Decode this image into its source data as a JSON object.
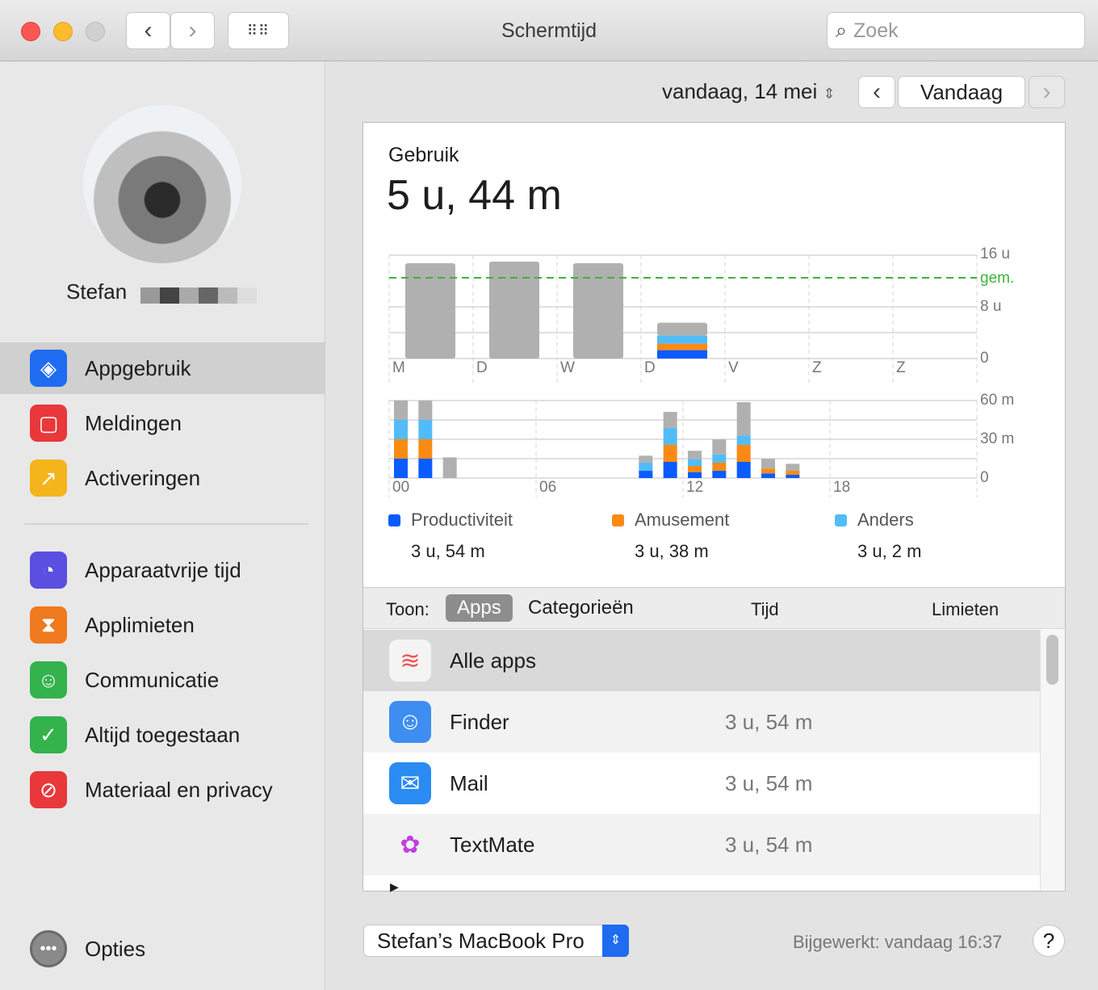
{
  "window": {
    "title": "Schermtijd",
    "search_placeholder": "Zoek"
  },
  "date_nav": {
    "date": "vandaag, 14 mei",
    "today_button": "Vandaag"
  },
  "user": {
    "name": "Stefan"
  },
  "sidebar": {
    "items": [
      {
        "label": "Appgebruik",
        "icon": "layers-icon",
        "color": "#1f6cf0",
        "selected": true
      },
      {
        "label": "Meldingen",
        "icon": "notification-icon",
        "color": "#e8383b"
      },
      {
        "label": "Activeringen",
        "icon": "pickup-icon",
        "color": "#f3b51b"
      },
      {
        "label": "Apparaatvrije tijd",
        "icon": "downtime-icon",
        "color": "#5a4fe0"
      },
      {
        "label": "Applimieten",
        "icon": "hourglass-icon",
        "color": "#f07a1e"
      },
      {
        "label": "Communicatie",
        "icon": "contact-icon",
        "color": "#34b24c"
      },
      {
        "label": "Altijd toegestaan",
        "icon": "checkmark-badge-icon",
        "color": "#34b24c"
      },
      {
        "label": "Materiaal en privacy",
        "icon": "restriction-icon",
        "color": "#e8383b"
      }
    ],
    "options_label": "Opties"
  },
  "usage": {
    "heading": "Gebruik",
    "total": "5 u, 44 m"
  },
  "colors": {
    "Productiviteit": "#0a5cff",
    "Amusement": "#fb8a14",
    "Anders": "#52bcf8",
    "other": "#b0b0b0",
    "average": "#3bb33b"
  },
  "chart_data": [
    {
      "type": "bar",
      "stacked": true,
      "categories": [
        "M",
        "D",
        "W",
        "D",
        "V",
        "Z",
        "Z"
      ],
      "y_ticks": [
        "16 u",
        "8 u",
        "0"
      ],
      "ylim": [
        0,
        16
      ],
      "average_label": "gem.",
      "average": 12.5,
      "series": [
        {
          "name": "Productiviteit",
          "values": [
            0,
            0,
            0,
            1.3,
            0,
            0,
            0
          ]
        },
        {
          "name": "Amusement",
          "values": [
            0,
            0,
            0,
            1.0,
            0,
            0,
            0
          ]
        },
        {
          "name": "Anders",
          "values": [
            0,
            0,
            0,
            1.25,
            0,
            0,
            0
          ]
        },
        {
          "values": [
            14.75,
            15,
            14.75,
            2.0,
            0,
            0,
            0
          ]
        }
      ]
    },
    {
      "type": "bar",
      "stacked": true,
      "x_ticks": [
        "00",
        "06",
        "12",
        "18"
      ],
      "y_ticks": [
        "60 m",
        "30 m",
        "0"
      ],
      "ylim": [
        0,
        60
      ],
      "hours": [
        0,
        1,
        2,
        10,
        11,
        12,
        13,
        14,
        15,
        16
      ],
      "series": [
        {
          "name": "Productiviteit",
          "values": [
            15,
            15,
            0,
            5.6,
            12.5,
            4.6,
            5.6,
            12.5,
            3.6,
            2.5
          ]
        },
        {
          "name": "Amusement",
          "values": [
            15,
            15,
            0,
            0,
            13.2,
            4.8,
            6.3,
            13.2,
            3.8,
            3.1
          ]
        },
        {
          "name": "Anders",
          "values": [
            15,
            15,
            0,
            6.3,
            13,
            5.2,
            6.3,
            7.3,
            0,
            0
          ]
        },
        {
          "values": [
            15,
            15,
            16,
            5.4,
            12.5,
            6.5,
            11.7,
            25.7,
            7.5,
            5.4
          ]
        }
      ]
    }
  ],
  "legend": [
    {
      "name": "Productiviteit",
      "value": "3 u, 54 m"
    },
    {
      "name": "Amusement",
      "value": "3 u, 38 m"
    },
    {
      "name": "Anders",
      "value": "3 u, 2 m"
    }
  ],
  "list": {
    "show_label": "Toon:",
    "tabs": [
      "Apps",
      "Categorieën"
    ],
    "columns": [
      "Tijd",
      "Limieten"
    ],
    "rows": [
      {
        "name": "Alle apps",
        "time": "",
        "icon": "stack-icon"
      },
      {
        "name": "Finder",
        "time": "3 u, 54 m",
        "icon": "finder-icon"
      },
      {
        "name": "Mail",
        "time": "3 u, 54 m",
        "icon": "mail-icon"
      },
      {
        "name": "TextMate",
        "time": "3 u, 54 m",
        "icon": "textmate-icon"
      }
    ]
  },
  "footer": {
    "device": "Stefan’s MacBook Pro",
    "updated": "Bijgewerkt: vandaag 16:37",
    "help": "?"
  }
}
